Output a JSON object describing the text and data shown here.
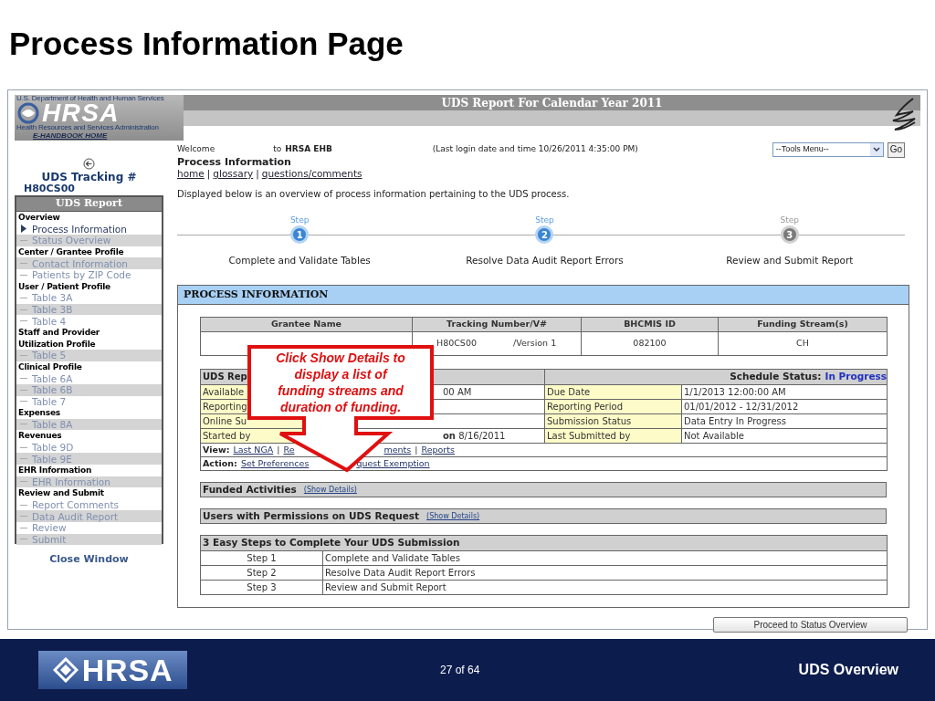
{
  "slide_title": "Process Information Page",
  "header": {
    "agency": "U.S. Department of Health and Human Services",
    "logo": "HRSA",
    "agency_sub": "Health Resources and Services Administration",
    "home_link": "E-HANDBOOK HOME",
    "title": "UDS Report For Calendar Year 2011"
  },
  "sidebar": {
    "tracking_label": "UDS Tracking #",
    "tracking_number": "H80CS00",
    "menu_title": "UDS Report",
    "groups": [
      {
        "title": "Overview",
        "items": [
          {
            "label": "Process Information",
            "selected": true,
            "shaded": false
          },
          {
            "label": "Status Overview",
            "selected": false,
            "shaded": true
          }
        ]
      },
      {
        "title": "Center / Grantee Profile",
        "items": [
          {
            "label": "Contact Information",
            "selected": false,
            "shaded": true
          },
          {
            "label": "Patients by ZIP Code",
            "selected": false,
            "shaded": false
          }
        ]
      },
      {
        "title": "User / Patient Profile",
        "items": [
          {
            "label": "Table 3A",
            "selected": false,
            "shaded": false
          },
          {
            "label": "Table 3B",
            "selected": false,
            "shaded": true
          },
          {
            "label": "Table 4",
            "selected": false,
            "shaded": false
          }
        ]
      },
      {
        "title": "Staff and Provider Utilization Profile",
        "items": [
          {
            "label": "Table 5",
            "selected": false,
            "shaded": true
          }
        ]
      },
      {
        "title": "Clinical Profile",
        "items": [
          {
            "label": "Table 6A",
            "selected": false,
            "shaded": false
          },
          {
            "label": "Table 6B",
            "selected": false,
            "shaded": true
          },
          {
            "label": "Table 7",
            "selected": false,
            "shaded": false
          }
        ]
      },
      {
        "title": "Expenses",
        "items": [
          {
            "label": "Table 8A",
            "selected": false,
            "shaded": true
          }
        ]
      },
      {
        "title": "Revenues",
        "items": [
          {
            "label": "Table 9D",
            "selected": false,
            "shaded": false
          },
          {
            "label": "Table 9E",
            "selected": false,
            "shaded": true
          }
        ]
      },
      {
        "title": "EHR Information",
        "items": [
          {
            "label": "EHR Information",
            "selected": false,
            "shaded": true
          }
        ]
      },
      {
        "title": "Review and Submit",
        "items": [
          {
            "label": "Report Comments",
            "selected": false,
            "shaded": false
          },
          {
            "label": "Data Audit Report",
            "selected": false,
            "shaded": true
          },
          {
            "label": "Review",
            "selected": false,
            "shaded": false
          },
          {
            "label": "Submit",
            "selected": false,
            "shaded": true
          }
        ]
      }
    ],
    "close": "Close Window"
  },
  "welcome": {
    "greeting": "Welcome",
    "joiner": "to",
    "site": "HRSA EHB",
    "last_login": "(Last login date and time 10/26/2011 4:35:00 PM)"
  },
  "tools_menu": {
    "value": "--Tools Menu--",
    "button": "Go"
  },
  "page_heading": "Process Information",
  "links": [
    {
      "kind": "link",
      "text": "home"
    },
    {
      "kind": "separator",
      "text": "|"
    },
    {
      "kind": "link",
      "text": "glossary"
    },
    {
      "kind": "separator",
      "text": "|"
    },
    {
      "kind": "link",
      "text": "questions/comments"
    }
  ],
  "description": "Displayed below is an overview of process information pertaining to the UDS process.",
  "steps": [
    {
      "caption": "Step",
      "number": "1",
      "label": "Complete and Validate Tables",
      "active": true
    },
    {
      "caption": "Step",
      "number": "2",
      "label": "Resolve Data Audit Report Errors",
      "active": true
    },
    {
      "caption": "Step",
      "number": "3",
      "label": "Review and Submit Report",
      "active": false
    }
  ],
  "panel": {
    "title": "PROCESS INFORMATION",
    "grantee_table": {
      "columns": [
        "Grantee Name",
        "Tracking Number/V#",
        "BHCMIS ID",
        "Funding Stream(s)"
      ],
      "tracking_number": "H80CS00",
      "version": "/Version 1",
      "bhcmis_id": "082100",
      "funding_streams": "CH"
    },
    "uds_table": {
      "title": "UDS Rep",
      "schedule_label": "Schedule Status:",
      "schedule_value": "In Progress",
      "rows": [
        {
          "label": "Available",
          "value": "00 AM",
          "label_2": "Due Date",
          "value_2": "1/1/2013 12:00:00 AM"
        },
        {
          "label": "Reporting",
          "label_2": "Reporting Period",
          "value_2": "01/01/2012 - 12/31/2012"
        },
        {
          "label": "Online Su",
          "label_2": "Submission Status",
          "value_2": "Data Entry In Progress"
        },
        {
          "label": "Started by",
          "value": "**on** 8/16/2011",
          "label_2": "Last Submitted by",
          "value_2": "Not Available"
        }
      ],
      "view": {
        "label": "View:",
        "items": [
          {
            "kind": "link",
            "text": "Last NGA"
          },
          {
            "kind": "separator",
            "text": "|"
          },
          {
            "kind": "link",
            "text": "Re"
          },
          {
            "kind": "tail",
            "text": "ments"
          },
          {
            "kind": "separator",
            "text": "|"
          },
          {
            "kind": "link",
            "text": "Reports"
          }
        ]
      },
      "action": {
        "label": "Action:",
        "items": [
          {
            "kind": "link",
            "text": "Set Preferences"
          },
          {
            "kind": "tail",
            "text": "quest Exemption"
          }
        ]
      }
    },
    "sections": [
      {
        "title": "Funded Activities",
        "link": "(Show Details)"
      },
      {
        "title": "Users with Permissions on UDS Request",
        "link": "(Show Details)"
      }
    ],
    "steps_table": {
      "title": "3 Easy Steps to Complete Your UDS Submission",
      "rows": [
        [
          "Step 1",
          "Complete and Validate Tables"
        ],
        [
          "Step 2",
          "Resolve Data Audit Report Errors"
        ],
        [
          "Step 3",
          "Review and Submit Report"
        ]
      ]
    }
  },
  "proceed_button": "Proceed to Status Overview",
  "callout": [
    "Click Show Details to",
    "display a list of",
    "funding streams and",
    "duration of funding."
  ],
  "footer": {
    "logo": "HRSA",
    "page": "27 of 64",
    "title": "UDS Overview"
  }
}
